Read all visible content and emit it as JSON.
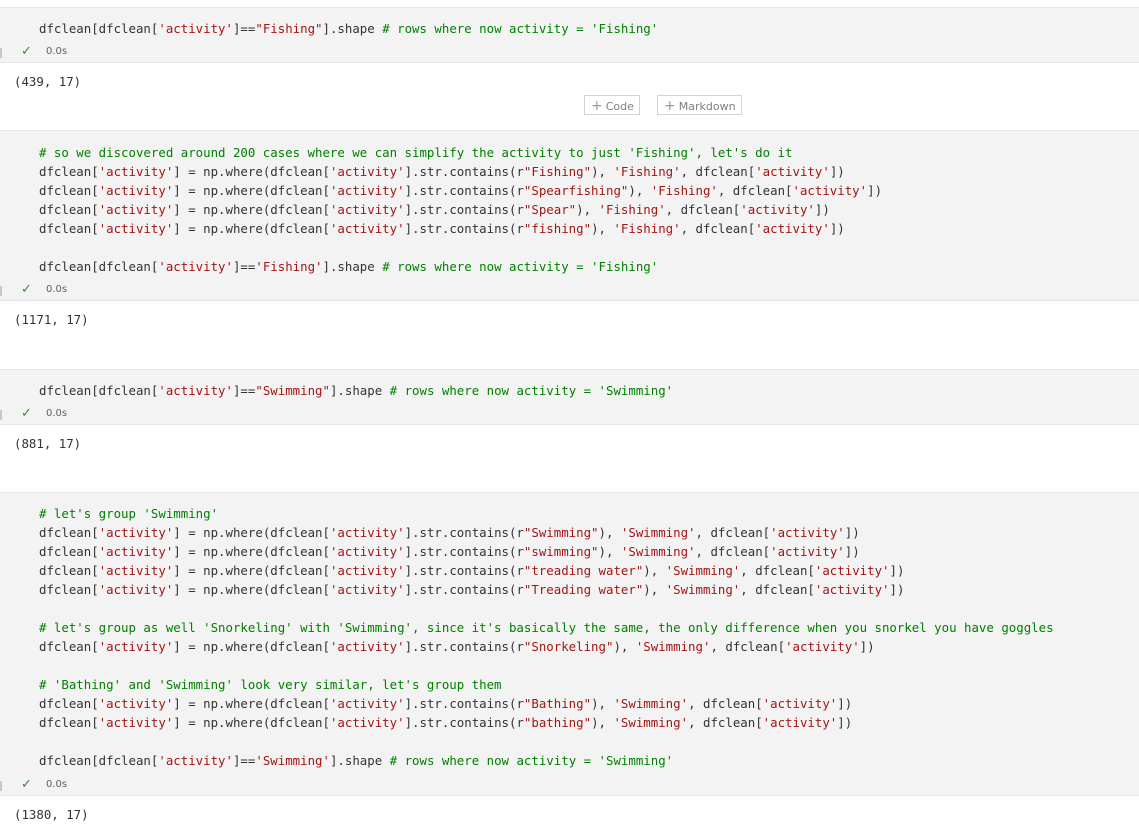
{
  "toolbar": {
    "add_code_label": "Code",
    "add_markdown_label": "Markdown",
    "plus_icon": "+"
  },
  "cells": [
    {
      "status": "0.0s",
      "output": "(439, 17)",
      "lines": [
        "dfclean[dfclean['activity']==\"Fishing\"].shape # rows where now activity = 'Fishing'"
      ]
    },
    {
      "status": "0.0s",
      "output": "(1171, 17)",
      "lines": [
        "# so we discovered around 200 cases where we can simplify the activity to just 'Fishing', let's do it",
        "dfclean['activity'] = np.where(dfclean['activity'].str.contains(r\"Fishing\"), 'Fishing', dfclean['activity'])",
        "dfclean['activity'] = np.where(dfclean['activity'].str.contains(r\"Spearfishing\"), 'Fishing', dfclean['activity'])",
        "dfclean['activity'] = np.where(dfclean['activity'].str.contains(r\"Spear\"), 'Fishing', dfclean['activity'])",
        "dfclean['activity'] = np.where(dfclean['activity'].str.contains(r\"fishing\"), 'Fishing', dfclean['activity'])",
        "",
        "dfclean[dfclean['activity']=='Fishing'].shape # rows where now activity = 'Fishing'"
      ]
    },
    {
      "status": "0.0s",
      "output": "(881, 17)",
      "lines": [
        "dfclean[dfclean['activity']==\"Swimming\"].shape # rows where now activity = 'Swimming'"
      ]
    },
    {
      "status": "0.0s",
      "output": "(1380, 17)",
      "lines": [
        "# let's group 'Swimming'",
        "dfclean['activity'] = np.where(dfclean['activity'].str.contains(r\"Swimming\"), 'Swimming', dfclean['activity'])",
        "dfclean['activity'] = np.where(dfclean['activity'].str.contains(r\"swimming\"), 'Swimming', dfclean['activity'])",
        "dfclean['activity'] = np.where(dfclean['activity'].str.contains(r\"treading water\"), 'Swimming', dfclean['activity'])",
        "dfclean['activity'] = np.where(dfclean['activity'].str.contains(r\"Treading water\"), 'Swimming', dfclean['activity'])",
        "",
        "# let's group as well 'Snorkeling' with 'Swimming', since it's basically the same, the only difference when you snorkel you have goggles",
        "dfclean['activity'] = np.where(dfclean['activity'].str.contains(r\"Snorkeling\"), 'Swimming', dfclean['activity'])",
        "",
        "# 'Bathing' and 'Swimming' look very similar, let's group them",
        "dfclean['activity'] = np.where(dfclean['activity'].str.contains(r\"Bathing\"), 'Swimming', dfclean['activity'])",
        "dfclean['activity'] = np.where(dfclean['activity'].str.contains(r\"bathing\"), 'Swimming', dfclean['activity'])",
        "",
        "dfclean[dfclean['activity']=='Swimming'].shape # rows where now activity = 'Swimming'"
      ]
    }
  ],
  "colors": {
    "cell_bg": "#f3f3f3",
    "string": "#a31515",
    "comment": "#008000",
    "check": "#388a34"
  }
}
